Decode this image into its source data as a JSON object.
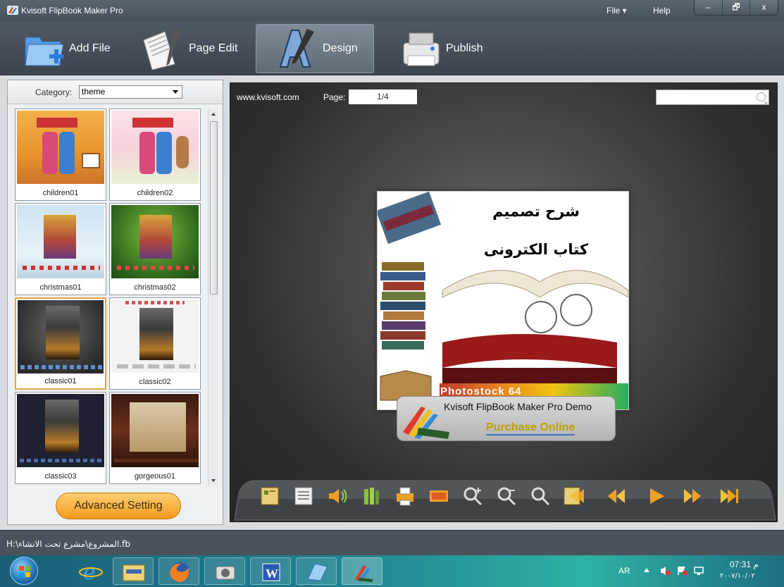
{
  "window": {
    "title": "Kvisoft FlipBook Maker Pro",
    "menu": {
      "file": "File ▾",
      "help": "Help"
    },
    "controls": {
      "minimize": "–",
      "maximize": "🗗",
      "close": "x"
    }
  },
  "toolbar": {
    "add_file": "Add File",
    "page_edit": "Page Edit",
    "design": "Design",
    "publish": "Publish",
    "active": "design"
  },
  "sidebar": {
    "category_label": "Category:",
    "category_value": "theme",
    "themes": [
      {
        "label": "children01"
      },
      {
        "label": "children02"
      },
      {
        "label": "christmas01"
      },
      {
        "label": "christmas02"
      },
      {
        "label": "classic01",
        "selected": true
      },
      {
        "label": "classic02"
      },
      {
        "label": "classic03"
      },
      {
        "label": "gorgeous01"
      }
    ],
    "advanced_button": "Advanced Setting"
  },
  "preview": {
    "site": "www.kvisoft.com",
    "page_label": "Page:",
    "page_value": "1/4",
    "book": {
      "title_line1": "شرح تصميم",
      "title_line2": "كتاب الكترونى",
      "stock_text": "Photostock 64"
    },
    "demo": {
      "title": "Kvisoft FlipBook Maker Pro Demo",
      "link": "Purchase Online"
    },
    "controls": [
      "thumbnails-icon",
      "table-of-contents-icon",
      "sound-icon",
      "share-icon",
      "print-icon",
      "fullscreen-icon",
      "zoom-in-icon",
      "zoom-out-icon",
      "search-icon",
      "first-page-icon",
      "previous-page-icon",
      "play-icon",
      "next-page-icon",
      "last-page-icon"
    ]
  },
  "status": {
    "path": "H:\\المشروع\\مشرع تحت الانشاء.fb"
  },
  "taskbar": {
    "lang": "AR",
    "time": "07:31 م",
    "date": "٢٠٠٧/١٠/٠٢"
  },
  "colors": {
    "accent_orange": "#f39a1c",
    "selected_border": "#e7a14b",
    "link_gold": "#c0a000"
  }
}
